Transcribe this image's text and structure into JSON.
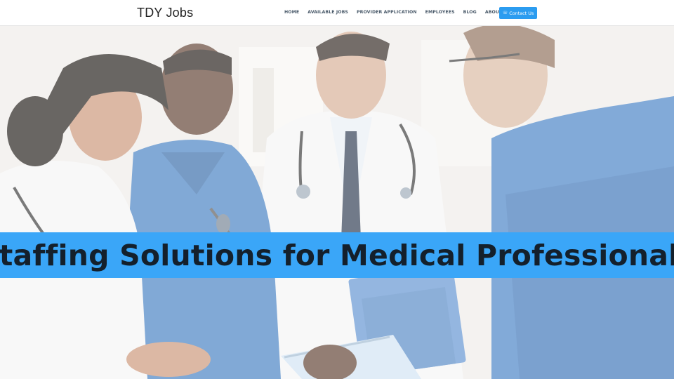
{
  "site": {
    "logo": "TDY Jobs"
  },
  "nav": {
    "items": [
      {
        "id": "home",
        "label": "HOME"
      },
      {
        "id": "available-jobs",
        "label": "AVAILABLE JOBS"
      },
      {
        "id": "provider-application",
        "label": "PROVIDER APPLICATION"
      },
      {
        "id": "employees",
        "label": "EMPLOYEES"
      },
      {
        "id": "blog",
        "label": "BLOG"
      },
      {
        "id": "about-us",
        "label": "ABOUT US"
      }
    ],
    "contact_button": {
      "label": "Contact Us",
      "icon": "phone-icon"
    }
  },
  "hero": {
    "headline": "Staffing Solutions for Medical Professionals",
    "banner_color": "#3aa6f8",
    "image_subject": "medical-team-photo"
  },
  "colors": {
    "accent": "#2b9cf0",
    "scrubs": "#4a86c8",
    "lab_coat": "#f4f4f4"
  }
}
